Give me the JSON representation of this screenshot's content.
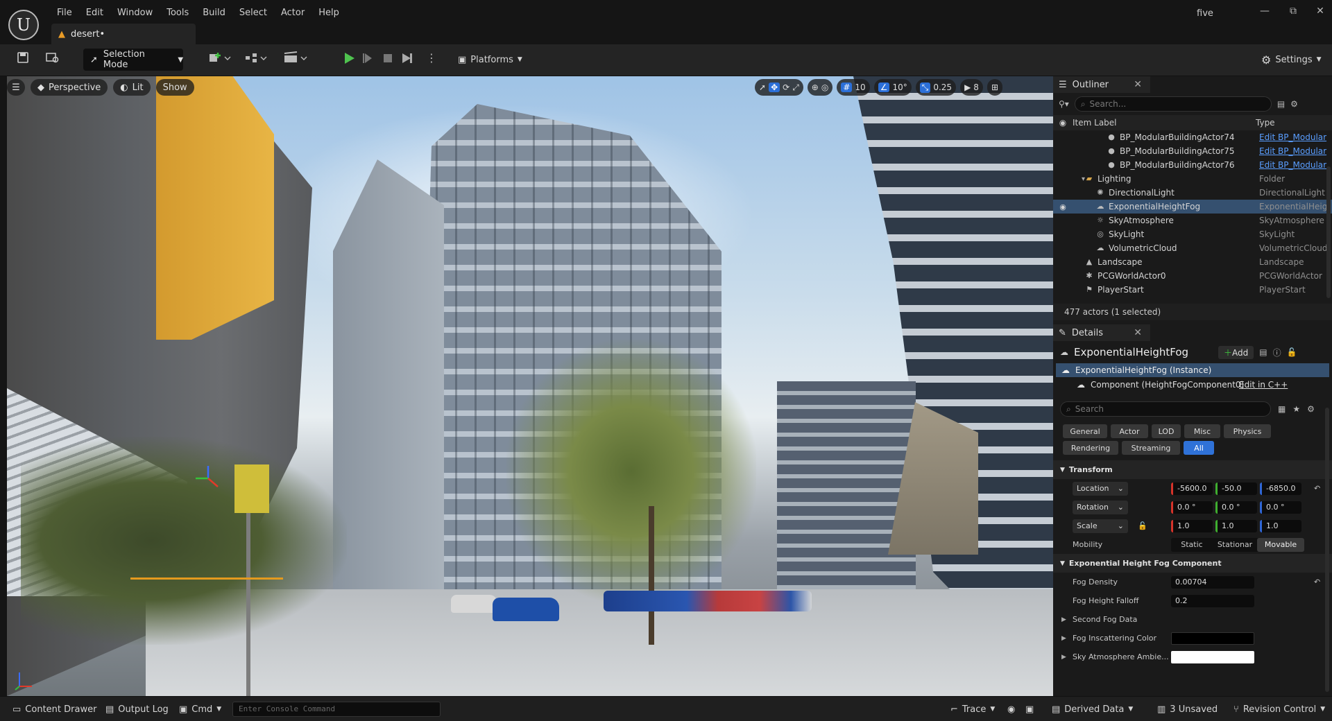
{
  "menu": [
    "File",
    "Edit",
    "Window",
    "Tools",
    "Build",
    "Select",
    "Actor",
    "Help"
  ],
  "doc_tab": {
    "title": "desert•"
  },
  "project_name": "five",
  "window_controls": {
    "minimize": "—",
    "maximize": "⧉",
    "close": "✕"
  },
  "toolbar": {
    "selection_mode": "Selection Mode",
    "platforms": "Platforms",
    "settings": "Settings"
  },
  "viewport": {
    "perspective": "Perspective",
    "lit": "Lit",
    "show": "Show",
    "grid_snap": "10",
    "rot_snap": "10°",
    "scale_snap": "0.25",
    "camera_speed": "8"
  },
  "outliner": {
    "tab": "Outliner",
    "search_placeholder": "Search...",
    "col_label": "Item Label",
    "col_type": "Type",
    "rows": [
      {
        "label": "BP_ModularBuildingActor74",
        "type": "Edit BP_Modular",
        "link": true,
        "indent": 2,
        "icon": "sphere-icon"
      },
      {
        "label": "BP_ModularBuildingActor75",
        "type": "Edit BP_Modular",
        "link": true,
        "indent": 2,
        "icon": "sphere-icon"
      },
      {
        "label": "BP_ModularBuildingActor76",
        "type": "Edit BP_Modular",
        "link": true,
        "indent": 2,
        "icon": "sphere-icon"
      },
      {
        "label": "Lighting",
        "type": "Folder",
        "link": false,
        "indent": 0,
        "icon": "folder-icon"
      },
      {
        "label": "DirectionalLight",
        "type": "DirectionalLight",
        "link": false,
        "indent": 1,
        "icon": "sun-icon"
      },
      {
        "label": "ExponentialHeightFog",
        "type": "ExponentialHeigh",
        "link": false,
        "indent": 1,
        "icon": "fog-icon",
        "selected": true
      },
      {
        "label": "SkyAtmosphere",
        "type": "SkyAtmosphere",
        "link": false,
        "indent": 1,
        "icon": "atmosphere-icon"
      },
      {
        "label": "SkyLight",
        "type": "SkyLight",
        "link": false,
        "indent": 1,
        "icon": "skylight-icon"
      },
      {
        "label": "VolumetricCloud",
        "type": "VolumetricCloud",
        "link": false,
        "indent": 1,
        "icon": "cloud-icon"
      },
      {
        "label": "Landscape",
        "type": "Landscape",
        "link": false,
        "indent": 0,
        "icon": "landscape-icon"
      },
      {
        "label": "PCGWorldActor0",
        "type": "PCGWorldActor",
        "link": false,
        "indent": 0,
        "icon": "pcg-icon"
      },
      {
        "label": "PlayerStart",
        "type": "PlayerStart",
        "link": false,
        "indent": 0,
        "icon": "flag-icon"
      }
    ],
    "footer": "477 actors (1 selected)"
  },
  "details": {
    "tab": "Details",
    "actor_name": "ExponentialHeightFog",
    "add_label": "Add",
    "instance": "ExponentialHeightFog (Instance)",
    "component": "Component (HeightFogComponent0)",
    "edit_cpp": "Edit in C++",
    "search_placeholder": "Search",
    "filters_row1": [
      "General",
      "Actor",
      "LOD",
      "Misc",
      "Physics"
    ],
    "filters_row2": [
      "Rendering",
      "Streaming",
      "All"
    ],
    "transform_header": "Transform",
    "location_label": "Location",
    "location": [
      "-5600.0",
      "-50.0",
      "-6850.0"
    ],
    "rotation_label": "Rotation",
    "rotation": [
      "0.0 °",
      "0.0 °",
      "0.0 °"
    ],
    "scale_label": "Scale",
    "scale": [
      "1.0",
      "1.0",
      "1.0"
    ],
    "mobility_label": "Mobility",
    "mobility_options": [
      "Static",
      "Stationar",
      "Movable"
    ],
    "fog_header": "Exponential Height Fog Component",
    "fog_density_label": "Fog Density",
    "fog_density": "0.00704",
    "fog_falloff_label": "Fog Height Falloff",
    "fog_falloff": "0.2",
    "second_fog_label": "Second Fog Data",
    "inscatter_label": "Fog Inscattering Color",
    "sky_ambient_label": "Sky Atmosphere Ambie..."
  },
  "bottom": {
    "content_drawer": "Content Drawer",
    "output_log": "Output Log",
    "cmd": "Cmd",
    "console_placeholder": "Enter Console Command",
    "trace": "Trace",
    "derived_data": "Derived Data",
    "unsaved": "3 Unsaved",
    "revision_control": "Revision Control"
  }
}
